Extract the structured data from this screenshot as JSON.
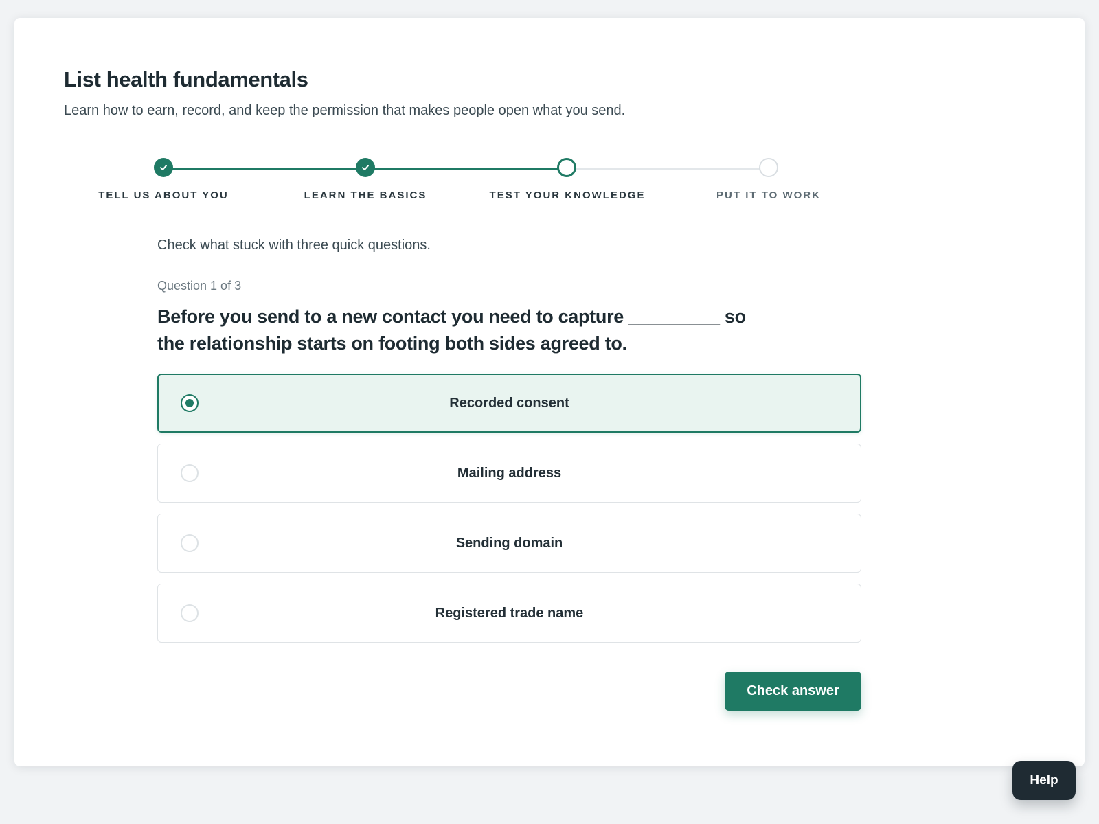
{
  "page": {
    "title": "List health fundamentals",
    "subtitle": "Learn how to earn, record, and keep the permission that makes people open what you send."
  },
  "stepper": {
    "steps": [
      {
        "label": "TELL US ABOUT YOU",
        "state": "done"
      },
      {
        "label": "LEARN THE BASICS",
        "state": "done"
      },
      {
        "label": "TEST YOUR KNOWLEDGE",
        "state": "current"
      },
      {
        "label": "PUT IT TO WORK",
        "state": "todo"
      }
    ]
  },
  "quiz": {
    "intro": "Check what stuck with three quick questions.",
    "counter": "Question 1 of 3",
    "question": "Before you send to a new contact you need to capture _________ so the relationship starts on footing both sides agreed to.",
    "options": [
      {
        "label": "Recorded consent",
        "selected": true
      },
      {
        "label": "Mailing address",
        "selected": false
      },
      {
        "label": "Sending domain",
        "selected": false
      },
      {
        "label": "Registered trade name",
        "selected": false
      }
    ],
    "check_label": "Check answer"
  },
  "help": {
    "label": "Help"
  },
  "colors": {
    "accent": "#1f7a64",
    "selected_bg": "#e9f4f0",
    "help_bg": "#1f2b33"
  },
  "icons": {
    "step_done": "check-icon"
  }
}
